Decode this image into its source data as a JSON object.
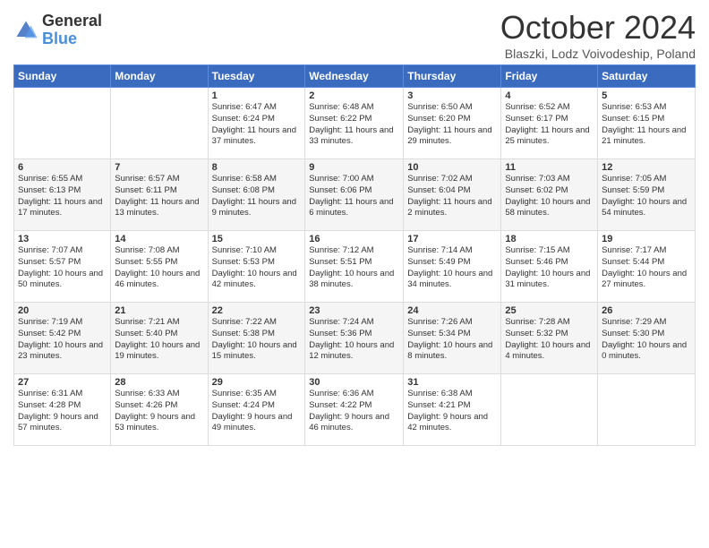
{
  "header": {
    "logo_general": "General",
    "logo_blue": "Blue",
    "month_title": "October 2024",
    "subtitle": "Blaszki, Lodz Voivodeship, Poland"
  },
  "weekdays": [
    "Sunday",
    "Monday",
    "Tuesday",
    "Wednesday",
    "Thursday",
    "Friday",
    "Saturday"
  ],
  "weeks": [
    [
      {
        "day": "",
        "sunrise": "",
        "sunset": "",
        "daylight": ""
      },
      {
        "day": "",
        "sunrise": "",
        "sunset": "",
        "daylight": ""
      },
      {
        "day": "1",
        "sunrise": "Sunrise: 6:47 AM",
        "sunset": "Sunset: 6:24 PM",
        "daylight": "Daylight: 11 hours and 37 minutes."
      },
      {
        "day": "2",
        "sunrise": "Sunrise: 6:48 AM",
        "sunset": "Sunset: 6:22 PM",
        "daylight": "Daylight: 11 hours and 33 minutes."
      },
      {
        "day": "3",
        "sunrise": "Sunrise: 6:50 AM",
        "sunset": "Sunset: 6:20 PM",
        "daylight": "Daylight: 11 hours and 29 minutes."
      },
      {
        "day": "4",
        "sunrise": "Sunrise: 6:52 AM",
        "sunset": "Sunset: 6:17 PM",
        "daylight": "Daylight: 11 hours and 25 minutes."
      },
      {
        "day": "5",
        "sunrise": "Sunrise: 6:53 AM",
        "sunset": "Sunset: 6:15 PM",
        "daylight": "Daylight: 11 hours and 21 minutes."
      }
    ],
    [
      {
        "day": "6",
        "sunrise": "Sunrise: 6:55 AM",
        "sunset": "Sunset: 6:13 PM",
        "daylight": "Daylight: 11 hours and 17 minutes."
      },
      {
        "day": "7",
        "sunrise": "Sunrise: 6:57 AM",
        "sunset": "Sunset: 6:11 PM",
        "daylight": "Daylight: 11 hours and 13 minutes."
      },
      {
        "day": "8",
        "sunrise": "Sunrise: 6:58 AM",
        "sunset": "Sunset: 6:08 PM",
        "daylight": "Daylight: 11 hours and 9 minutes."
      },
      {
        "day": "9",
        "sunrise": "Sunrise: 7:00 AM",
        "sunset": "Sunset: 6:06 PM",
        "daylight": "Daylight: 11 hours and 6 minutes."
      },
      {
        "day": "10",
        "sunrise": "Sunrise: 7:02 AM",
        "sunset": "Sunset: 6:04 PM",
        "daylight": "Daylight: 11 hours and 2 minutes."
      },
      {
        "day": "11",
        "sunrise": "Sunrise: 7:03 AM",
        "sunset": "Sunset: 6:02 PM",
        "daylight": "Daylight: 10 hours and 58 minutes."
      },
      {
        "day": "12",
        "sunrise": "Sunrise: 7:05 AM",
        "sunset": "Sunset: 5:59 PM",
        "daylight": "Daylight: 10 hours and 54 minutes."
      }
    ],
    [
      {
        "day": "13",
        "sunrise": "Sunrise: 7:07 AM",
        "sunset": "Sunset: 5:57 PM",
        "daylight": "Daylight: 10 hours and 50 minutes."
      },
      {
        "day": "14",
        "sunrise": "Sunrise: 7:08 AM",
        "sunset": "Sunset: 5:55 PM",
        "daylight": "Daylight: 10 hours and 46 minutes."
      },
      {
        "day": "15",
        "sunrise": "Sunrise: 7:10 AM",
        "sunset": "Sunset: 5:53 PM",
        "daylight": "Daylight: 10 hours and 42 minutes."
      },
      {
        "day": "16",
        "sunrise": "Sunrise: 7:12 AM",
        "sunset": "Sunset: 5:51 PM",
        "daylight": "Daylight: 10 hours and 38 minutes."
      },
      {
        "day": "17",
        "sunrise": "Sunrise: 7:14 AM",
        "sunset": "Sunset: 5:49 PM",
        "daylight": "Daylight: 10 hours and 34 minutes."
      },
      {
        "day": "18",
        "sunrise": "Sunrise: 7:15 AM",
        "sunset": "Sunset: 5:46 PM",
        "daylight": "Daylight: 10 hours and 31 minutes."
      },
      {
        "day": "19",
        "sunrise": "Sunrise: 7:17 AM",
        "sunset": "Sunset: 5:44 PM",
        "daylight": "Daylight: 10 hours and 27 minutes."
      }
    ],
    [
      {
        "day": "20",
        "sunrise": "Sunrise: 7:19 AM",
        "sunset": "Sunset: 5:42 PM",
        "daylight": "Daylight: 10 hours and 23 minutes."
      },
      {
        "day": "21",
        "sunrise": "Sunrise: 7:21 AM",
        "sunset": "Sunset: 5:40 PM",
        "daylight": "Daylight: 10 hours and 19 minutes."
      },
      {
        "day": "22",
        "sunrise": "Sunrise: 7:22 AM",
        "sunset": "Sunset: 5:38 PM",
        "daylight": "Daylight: 10 hours and 15 minutes."
      },
      {
        "day": "23",
        "sunrise": "Sunrise: 7:24 AM",
        "sunset": "Sunset: 5:36 PM",
        "daylight": "Daylight: 10 hours and 12 minutes."
      },
      {
        "day": "24",
        "sunrise": "Sunrise: 7:26 AM",
        "sunset": "Sunset: 5:34 PM",
        "daylight": "Daylight: 10 hours and 8 minutes."
      },
      {
        "day": "25",
        "sunrise": "Sunrise: 7:28 AM",
        "sunset": "Sunset: 5:32 PM",
        "daylight": "Daylight: 10 hours and 4 minutes."
      },
      {
        "day": "26",
        "sunrise": "Sunrise: 7:29 AM",
        "sunset": "Sunset: 5:30 PM",
        "daylight": "Daylight: 10 hours and 0 minutes."
      }
    ],
    [
      {
        "day": "27",
        "sunrise": "Sunrise: 6:31 AM",
        "sunset": "Sunset: 4:28 PM",
        "daylight": "Daylight: 9 hours and 57 minutes."
      },
      {
        "day": "28",
        "sunrise": "Sunrise: 6:33 AM",
        "sunset": "Sunset: 4:26 PM",
        "daylight": "Daylight: 9 hours and 53 minutes."
      },
      {
        "day": "29",
        "sunrise": "Sunrise: 6:35 AM",
        "sunset": "Sunset: 4:24 PM",
        "daylight": "Daylight: 9 hours and 49 minutes."
      },
      {
        "day": "30",
        "sunrise": "Sunrise: 6:36 AM",
        "sunset": "Sunset: 4:22 PM",
        "daylight": "Daylight: 9 hours and 46 minutes."
      },
      {
        "day": "31",
        "sunrise": "Sunrise: 6:38 AM",
        "sunset": "Sunset: 4:21 PM",
        "daylight": "Daylight: 9 hours and 42 minutes."
      },
      {
        "day": "",
        "sunrise": "",
        "sunset": "",
        "daylight": ""
      },
      {
        "day": "",
        "sunrise": "",
        "sunset": "",
        "daylight": ""
      }
    ]
  ]
}
